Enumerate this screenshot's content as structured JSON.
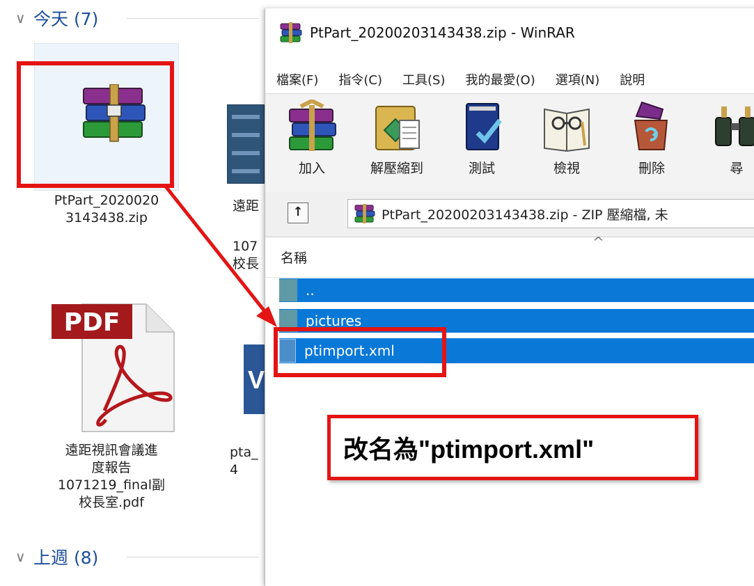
{
  "explorer": {
    "group_today": "今天 (7)",
    "group_last_week": "上週 (8)",
    "zip_file_label": "PtPart_2020020\n3143438.zip",
    "pdf_file_label": "遠距視訊會議進\n度報告\n1071219_final副\n校長室.pdf",
    "pdf_badge": "PDF",
    "peek_doc1_label": "遠距",
    "peek_doc1_sub": "107\n校長",
    "peek_word_letter": "V",
    "peek_doc2_label": "pta_\n4"
  },
  "winrar": {
    "title": "PtPart_20200203143438.zip - WinRAR",
    "menu": [
      "檔案(F)",
      "指令(C)",
      "工具(S)",
      "我的最愛(O)",
      "選項(N)",
      "說明"
    ],
    "toolbar": [
      "加入",
      "解壓縮到",
      "測試",
      "檢視",
      "刪除",
      "尋"
    ],
    "path_text": "PtPart_20200203143438.zip - ZIP 壓縮檔, 未",
    "column_name": "名稱",
    "files": [
      "..",
      "pictures",
      "ptimport.xml"
    ]
  },
  "annotation": {
    "rename_note": "改名為\"ptimport.xml\"",
    "highlight_color": "#e41414"
  },
  "colors": {
    "selection": "#0a78d7",
    "explorer_header": "#1c4f9c"
  }
}
